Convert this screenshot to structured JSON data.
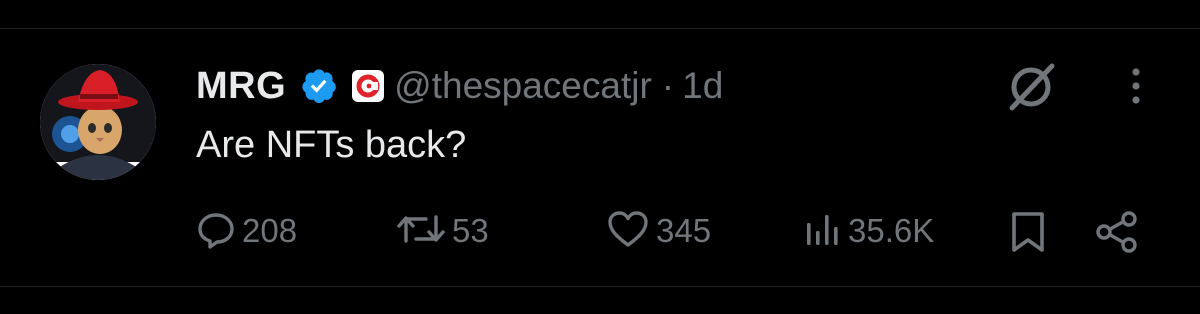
{
  "tweet": {
    "author": {
      "display_name": "MRG",
      "handle": "@thespacecatjr",
      "verified": true,
      "verified_color": "#1d9bf0"
    },
    "separator": "·",
    "time": "1d",
    "text": "Are NFTs back?"
  },
  "actions": {
    "replies": "208",
    "reposts": "53",
    "likes": "345",
    "views": "35.6K"
  },
  "icons": {
    "header": [
      "grok-icon",
      "more-options-icon"
    ],
    "bar": [
      "reply-icon",
      "repost-icon",
      "like-icon",
      "views-icon",
      "bookmark-icon",
      "share-icon"
    ]
  },
  "colors": {
    "background": "#000000",
    "text": "#e7e9ea",
    "muted": "#71767b",
    "accent": "#1d9bf0"
  }
}
